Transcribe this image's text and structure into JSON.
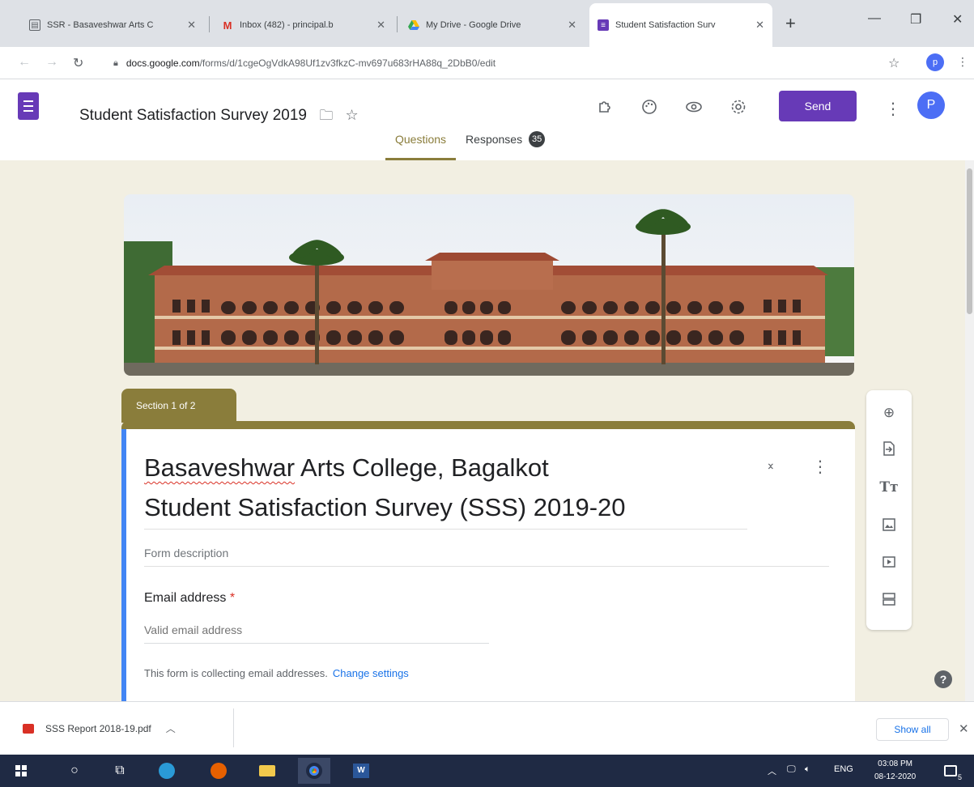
{
  "browser": {
    "tabs": [
      {
        "title": "SSR - Basaveshwar Arts C",
        "icon": "document-icon",
        "active": false
      },
      {
        "title": "Inbox (482) - principal.b",
        "icon": "gmail-icon",
        "active": false
      },
      {
        "title": "My Drive - Google Drive",
        "icon": "drive-icon",
        "active": false
      },
      {
        "title": "Student Satisfaction Surv",
        "icon": "forms-icon",
        "active": true
      }
    ],
    "url_domain": "docs.google.com",
    "url_path": "/forms/d/1cgeOgVdkA98Uf1zv3fkzC-mv697u683rHA88q_2DbB0/edit",
    "profile_initial": "p"
  },
  "app": {
    "form_title": "Student Satisfaction Survey 2019",
    "send_label": "Send",
    "avatar_initial": "P",
    "tabs": [
      {
        "label": "Questions",
        "active": true
      },
      {
        "label": "Responses",
        "active": false,
        "count": "35"
      }
    ]
  },
  "form": {
    "section_label": "Section 1 of 2",
    "title_line1_a": "Basaveshwar",
    "title_line1_b": " Arts College, Bagalkot",
    "title_line2": "Student Satisfaction Survey (SSS) 2019-20",
    "description_placeholder": "Form description",
    "email_label": "Email address",
    "required_mark": "*",
    "email_placeholder": "Valid email address",
    "collect_note": "This form is collecting email addresses.",
    "change_settings": "Change settings"
  },
  "downloads": {
    "file_name": "SSS Report 2018-19.pdf",
    "show_all": "Show all"
  },
  "taskbar": {
    "lang": "ENG",
    "time": "03:08 PM",
    "date": "08-12-2020",
    "notif_count": "5"
  },
  "colors": {
    "theme": "#8a7d3b",
    "canvas_bg": "#f2efe2",
    "accent_purple": "#673ab7",
    "section_blue": "#4285f4"
  }
}
